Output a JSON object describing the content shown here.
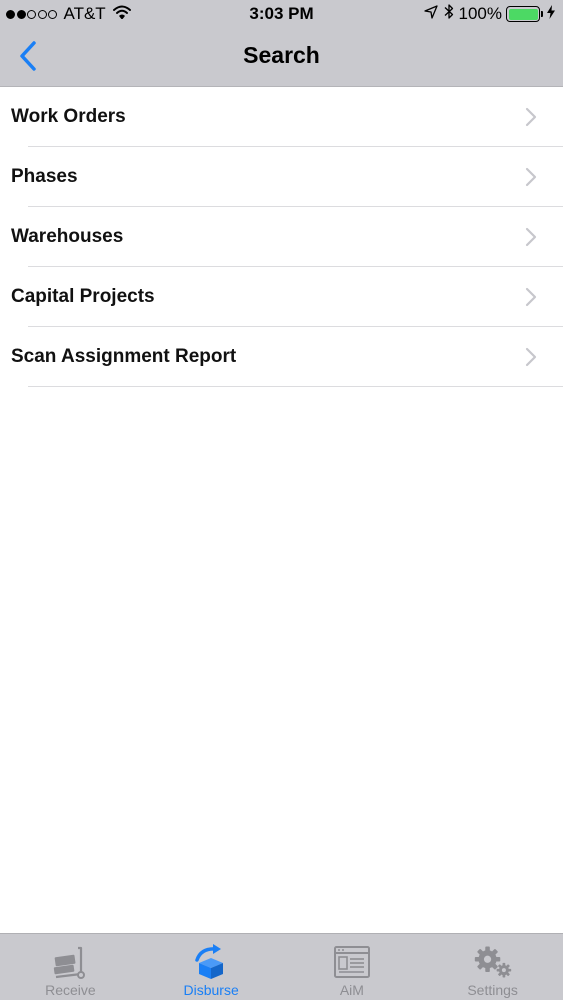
{
  "status_bar": {
    "carrier": "AT&T",
    "time": "3:03 PM",
    "battery_percent": "100%",
    "signal_dots_filled": 2,
    "signal_dots_total": 5
  },
  "nav": {
    "title": "Search",
    "back_icon": "chevron-left-icon"
  },
  "list": {
    "items": [
      {
        "label": "Work Orders"
      },
      {
        "label": "Phases"
      },
      {
        "label": "Warehouses"
      },
      {
        "label": "Capital Projects"
      },
      {
        "label": "Scan Assignment Report"
      }
    ]
  },
  "tabs": [
    {
      "label": "Receive",
      "icon": "hand-truck-icon",
      "active": false
    },
    {
      "label": "Disburse",
      "icon": "box-share-icon",
      "active": true
    },
    {
      "label": "AiM",
      "icon": "browser-window-icon",
      "active": false
    },
    {
      "label": "Settings",
      "icon": "gears-icon",
      "active": false
    }
  ],
  "colors": {
    "accent": "#1a7ff5",
    "bar_background": "#c9c9ce",
    "inactive_tab": "#8e8e93",
    "battery_fill": "#4cd964"
  }
}
